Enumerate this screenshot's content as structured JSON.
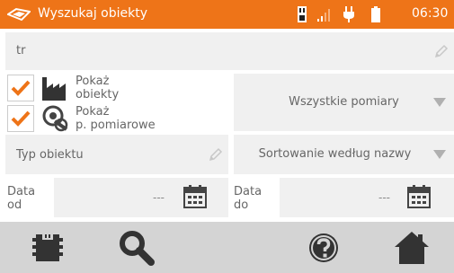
{
  "header": {
    "title": "Wyszukaj obiekty",
    "time": "06:30",
    "accent_color": "#ee7418"
  },
  "search": {
    "value": "tr"
  },
  "options": {
    "show_objects_label_line1": "Pokaż",
    "show_objects_label_line2": "obiekty",
    "show_objects_checked": true,
    "show_points_label_line1": "Pokaż",
    "show_points_label_line2": "p. pomiarowe",
    "show_points_checked": true
  },
  "measurements_dropdown": {
    "value": "Wszystkie pomiary"
  },
  "object_type": {
    "placeholder": "Typ obiektu"
  },
  "sort_dropdown": {
    "value": "Sortowanie według nazwy"
  },
  "date_from": {
    "label_line1": "Data",
    "label_line2": "od",
    "value": "---"
  },
  "date_to": {
    "label_line1": "Data",
    "label_line2": "do",
    "value": "---"
  },
  "toolbar": {
    "icons": [
      "memory-icon",
      "search-icon",
      "help-icon",
      "home-icon"
    ]
  }
}
